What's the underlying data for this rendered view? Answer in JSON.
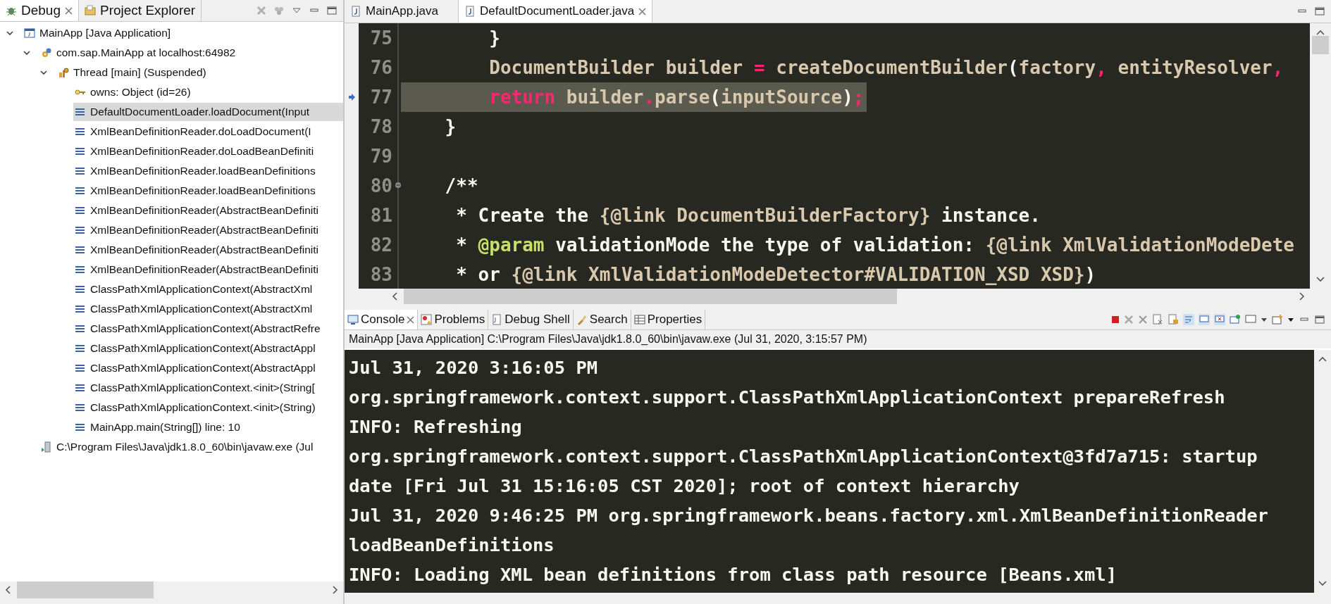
{
  "debug_view": {
    "tabs": [
      {
        "label": "Debug",
        "kind": "debug",
        "selected": true
      },
      {
        "label": "Project Explorer",
        "kind": "explorer",
        "selected": false
      }
    ],
    "tree": [
      {
        "label": "MainApp [Java Application]",
        "kind": "launch",
        "expanded": true,
        "selected": false,
        "children": [
          {
            "label": "com.sap.MainApp at localhost:64982",
            "kind": "target",
            "expanded": true,
            "selected": false,
            "children": [
              {
                "label": "Thread [main] (Suspended)",
                "kind": "thread",
                "expanded": true,
                "selected": false,
                "children": [
                  {
                    "label": "owns: Object  (id=26)",
                    "kind": "monitor",
                    "selected": false
                  },
                  {
                    "label": "DefaultDocumentLoader.loadDocument(Input",
                    "kind": "frame",
                    "selected": true
                  },
                  {
                    "label": "XmlBeanDefinitionReader.doLoadDocument(I",
                    "kind": "frame",
                    "selected": false
                  },
                  {
                    "label": "XmlBeanDefinitionReader.doLoadBeanDefiniti",
                    "kind": "frame",
                    "selected": false
                  },
                  {
                    "label": "XmlBeanDefinitionReader.loadBeanDefinitions",
                    "kind": "frame",
                    "selected": false
                  },
                  {
                    "label": "XmlBeanDefinitionReader.loadBeanDefinitions",
                    "kind": "frame",
                    "selected": false
                  },
                  {
                    "label": "XmlBeanDefinitionReader(AbstractBeanDefiniti",
                    "kind": "frame",
                    "selected": false
                  },
                  {
                    "label": "XmlBeanDefinitionReader(AbstractBeanDefiniti",
                    "kind": "frame",
                    "selected": false
                  },
                  {
                    "label": "XmlBeanDefinitionReader(AbstractBeanDefiniti",
                    "kind": "frame",
                    "selected": false
                  },
                  {
                    "label": "XmlBeanDefinitionReader(AbstractBeanDefiniti",
                    "kind": "frame",
                    "selected": false
                  },
                  {
                    "label": "ClassPathXmlApplicationContext(AbstractXml",
                    "kind": "frame",
                    "selected": false
                  },
                  {
                    "label": "ClassPathXmlApplicationContext(AbstractXml",
                    "kind": "frame",
                    "selected": false
                  },
                  {
                    "label": "ClassPathXmlApplicationContext(AbstractRefre",
                    "kind": "frame",
                    "selected": false
                  },
                  {
                    "label": "ClassPathXmlApplicationContext(AbstractAppl",
                    "kind": "frame",
                    "selected": false
                  },
                  {
                    "label": "ClassPathXmlApplicationContext(AbstractAppl",
                    "kind": "frame",
                    "selected": false
                  },
                  {
                    "label": "ClassPathXmlApplicationContext.<init>(String[",
                    "kind": "frame",
                    "selected": false
                  },
                  {
                    "label": "ClassPathXmlApplicationContext.<init>(String)",
                    "kind": "frame",
                    "selected": false
                  },
                  {
                    "label": "MainApp.main(String[]) line: 10",
                    "kind": "frame",
                    "selected": false
                  }
                ]
              }
            ]
          },
          {
            "label": "C:\\Program Files\\Java\\jdk1.8.0_60\\bin\\javaw.exe (Jul",
            "kind": "process",
            "selected": false
          }
        ]
      }
    ]
  },
  "editor": {
    "tabs": [
      {
        "label": "MainApp.java",
        "selected": false
      },
      {
        "label": "DefaultDocumentLoader.java",
        "selected": true
      }
    ],
    "lines": [
      {
        "number": "75",
        "current": false,
        "foldable": false,
        "tokens": [
          {
            "text": "        }",
            "kind": "plain"
          }
        ]
      },
      {
        "number": "76",
        "current": false,
        "foldable": false,
        "tokens": [
          {
            "text": "        DocumentBuilder builder ",
            "kind": "text"
          },
          {
            "text": "=",
            "kind": "operator"
          },
          {
            "text": " createDocumentBuilder",
            "kind": "text"
          },
          {
            "text": "(",
            "kind": "plain"
          },
          {
            "text": "factory",
            "kind": "text"
          },
          {
            "text": ",",
            "kind": "operator"
          },
          {
            "text": " entityResolver",
            "kind": "text"
          },
          {
            "text": ",",
            "kind": "operator"
          }
        ]
      },
      {
        "number": "77",
        "current": true,
        "foldable": false,
        "tokens": [
          {
            "text": "        return",
            "kind": "keyword"
          },
          {
            "text": " builder",
            "kind": "text"
          },
          {
            "text": ".",
            "kind": "operator"
          },
          {
            "text": "parse",
            "kind": "text"
          },
          {
            "text": "(",
            "kind": "plain"
          },
          {
            "text": "inputSource",
            "kind": "text"
          },
          {
            "text": ")",
            "kind": "plain"
          },
          {
            "text": ";",
            "kind": "operator"
          }
        ]
      },
      {
        "number": "78",
        "current": false,
        "foldable": false,
        "tokens": [
          {
            "text": "    }",
            "kind": "plain"
          }
        ]
      },
      {
        "number": "79",
        "current": false,
        "foldable": false
      },
      {
        "number": "80",
        "current": false,
        "foldable": true,
        "tokens": [
          {
            "text": "    /**",
            "kind": "plain"
          }
        ]
      },
      {
        "number": "81",
        "current": false,
        "foldable": false,
        "tokens": [
          {
            "text": "     * Create the ",
            "kind": "plain"
          },
          {
            "text": "{@link DocumentBuilderFactory}",
            "kind": "text"
          },
          {
            "text": " instance.",
            "kind": "plain"
          }
        ]
      },
      {
        "number": "82",
        "current": false,
        "foldable": false,
        "tokens": [
          {
            "text": "     * ",
            "kind": "plain"
          },
          {
            "text": "@param",
            "kind": "tag"
          },
          {
            "text": " validationMode the type of validation: ",
            "kind": "plain"
          },
          {
            "text": "{@link XmlValidationModeDete",
            "kind": "text"
          }
        ]
      },
      {
        "number": "83",
        "current": false,
        "foldable": false,
        "tokens": [
          {
            "text": "     * or ",
            "kind": "plain"
          },
          {
            "text": "{@link XmlValidationModeDetector#VALIDATION_XSD XSD}",
            "kind": "text"
          },
          {
            "text": ")",
            "kind": "plain"
          }
        ]
      }
    ]
  },
  "console_view": {
    "tabs": [
      {
        "label": "Console",
        "kind": "console",
        "selected": true
      },
      {
        "label": "Problems",
        "kind": "problems",
        "selected": false
      },
      {
        "label": "Debug Shell",
        "kind": "shell",
        "selected": false
      },
      {
        "label": "Search",
        "kind": "search",
        "selected": false
      },
      {
        "label": "Properties",
        "kind": "properties",
        "selected": false
      }
    ],
    "title": "MainApp [Java Application] C:\\Program Files\\Java\\jdk1.8.0_60\\bin\\javaw.exe (Jul 31, 2020, 3:15:57 PM)",
    "lines": [
      "Jul 31, 2020 3:16:05 PM",
      "org.springframework.context.support.ClassPathXmlApplicationContext prepareRefresh",
      "INFO: Refreshing",
      "org.springframework.context.support.ClassPathXmlApplicationContext@3fd7a715: startup",
      "date [Fri Jul 31 15:16:05 CST 2020]; root of context hierarchy",
      "Jul 31, 2020 9:46:25 PM org.springframework.beans.factory.xml.XmlBeanDefinitionReader",
      "loadBeanDefinitions",
      "INFO: Loading XML bean definitions from class path resource [Beans.xml]"
    ]
  }
}
